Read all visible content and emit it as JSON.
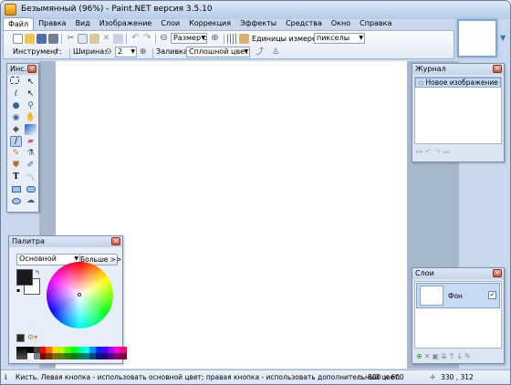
{
  "window": {
    "title": "Безымянный (96%) - Paint.NET версия 3.5.10"
  },
  "menu": [
    "Файл",
    "Правка",
    "Вид",
    "Изображение",
    "Слои",
    "Коррекция",
    "Эффекты",
    "Средства",
    "Окно",
    "Справка"
  ],
  "toolbar": {
    "zoom_value": "Размер ог",
    "units_label": "Единицы измерения:",
    "units_value": "пикселы",
    "tool_label": "Инструмент:",
    "width_label": "Ширина:",
    "width_value": "2",
    "fill_label": "Заливка:",
    "fill_value": "Сплошной цвет"
  },
  "tools_panel": {
    "title": "Инс...",
    "selected": "paintbrush-tool"
  },
  "history_panel": {
    "title": "Журнал",
    "items": [
      "Новое изображение"
    ]
  },
  "palette_panel": {
    "title": "Палитра",
    "mode": "Основной",
    "more_label": "Больше >>",
    "swatches": [
      "#000000",
      "#404040",
      "#ff0000",
      "#ff6a00",
      "#ffd800",
      "#b6ff00",
      "#4cff00",
      "#00ff21",
      "#00ff90",
      "#00ffff",
      "#0094ff",
      "#0026ff",
      "#4800ff",
      "#b200ff",
      "#ff00dc",
      "#ff006e",
      "#ffffff",
      "#808080",
      "#7f0000",
      "#7f3300",
      "#7f6a00",
      "#5b7f00",
      "#267f00",
      "#007f0e",
      "#007f46",
      "#007f7f",
      "#004a7f",
      "#00137f",
      "#21007f",
      "#57007f",
      "#7f006e",
      "#7f0037"
    ],
    "primary_color": "#1a1a1a",
    "secondary_color": "#ffffff"
  },
  "layers_panel": {
    "title": "Слои",
    "layers": [
      {
        "name": "Фон",
        "visible": "✓"
      }
    ]
  },
  "status": {
    "hint": "Кисть. Левая кнопка - использовать основной цвет; правая кнопка - использовать дополнительный цвет.",
    "image_size": "800 × 600",
    "cursor_pos": "330 , 312"
  }
}
